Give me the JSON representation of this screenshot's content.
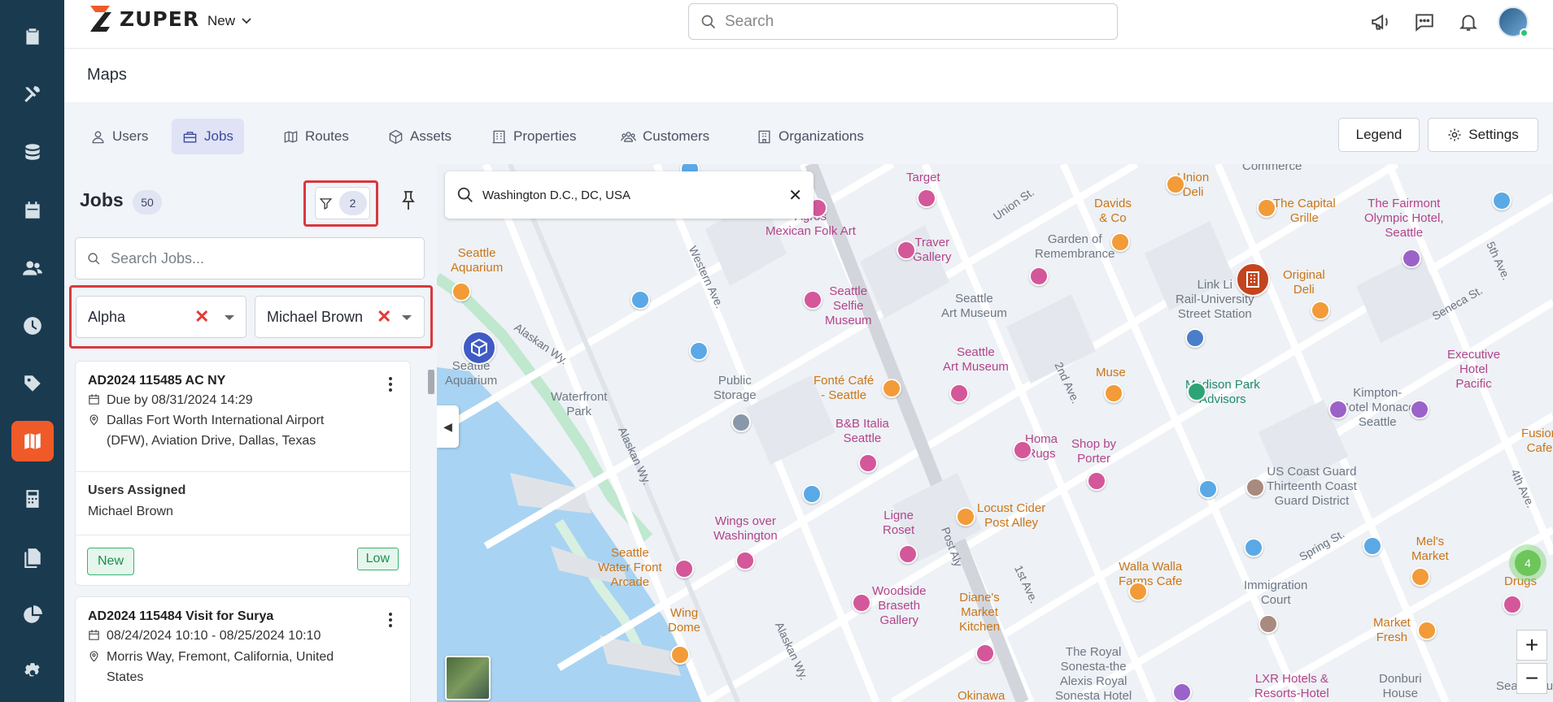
{
  "app": {
    "logo_text": "ZUPER",
    "new_label": "New",
    "search_placeholder": "Search"
  },
  "sidebar": {
    "items": [
      {
        "name": "clipboard-icon"
      },
      {
        "name": "tools-icon"
      },
      {
        "name": "database-icon"
      },
      {
        "name": "calendar-icon"
      },
      {
        "name": "users-icon"
      },
      {
        "name": "clock-icon"
      },
      {
        "name": "tag-icon"
      },
      {
        "name": "map-icon",
        "active": true
      },
      {
        "name": "calculator-icon"
      },
      {
        "name": "documents-icon"
      },
      {
        "name": "pie-chart-icon"
      },
      {
        "name": "gear-icon"
      }
    ]
  },
  "header": {
    "page_title": "Maps"
  },
  "tabs": [
    {
      "label": "Users",
      "icon": "user-icon"
    },
    {
      "label": "Jobs",
      "icon": "briefcase-icon",
      "active": true
    },
    {
      "label": "Routes",
      "icon": "map-icon"
    },
    {
      "label": "Assets",
      "icon": "cube-icon"
    },
    {
      "label": "Properties",
      "icon": "building-icon"
    },
    {
      "label": "Customers",
      "icon": "customers-icon"
    },
    {
      "label": "Organizations",
      "icon": "organization-icon"
    }
  ],
  "actions": {
    "legend_label": "Legend",
    "settings_label": "Settings"
  },
  "panel": {
    "title": "Jobs",
    "count": "50",
    "filter_count": "2",
    "search_placeholder": "Search Jobs...",
    "filters": [
      {
        "value": "Alpha"
      },
      {
        "value": "Michael Brown"
      }
    ]
  },
  "jobs": [
    {
      "title": "AD2024 115485 AC NY",
      "due": "Due by 08/31/2024 14:29",
      "address_line1": "Dallas Fort Worth International Airport",
      "address_line2": "(DFW), Aviation Drive, Dallas, Texas",
      "users_heading": "Users Assigned",
      "user": "Michael Brown",
      "status": "New",
      "priority": "Low"
    },
    {
      "title": "AD2024 115484 Visit for Surya",
      "due": "08/24/2024 10:10 - 08/25/2024 10:10",
      "address_line1": "Morris Way, Fremont, California, United",
      "address_line2": "States"
    }
  ],
  "map": {
    "search_value": "Washington D.C., DC, USA",
    "cluster_count": "4",
    "zoom_in": "+",
    "zoom_out": "−",
    "labels": {
      "commerce": "Commerce",
      "target": "Target",
      "union_deli": "Union\nDeli",
      "union_st": "Union St.",
      "davids": "Davids\n& Co",
      "capital_grille": "The Capital\nGrille",
      "fairmont": "The Fairmont\nOlympic Hotel,\nSeattle",
      "agros": "Agros\nMexican Folk Art",
      "traver": "Traver\nGallery",
      "garden": "Garden of\nRemembrance",
      "fifth": "5th Ave.",
      "aquarium": "Seattle\nAquarium",
      "western": "Western Ave.",
      "selfie": "Seattle\nSelfie\nMuseum",
      "art_museum1": "Seattle\nArt Museum",
      "link_light": "Link Li\nRail-University\nStreet Station",
      "original_deli": "Original\nDeli",
      "seneca": "Seneca St.",
      "alaskan1": "Alaskan Wy.",
      "aquarium2": "Seattle\nAquarium",
      "art_museum2": "Seattle\nArt Museum",
      "executive": "Executive\nHotel\nPacific",
      "public_storage": "Public\nStorage",
      "fonte": "Fonté Café\n- Seattle",
      "waterfront_park": "Waterfront\nPark",
      "muse": "Muse",
      "madison": "Madison Park\nAdvisors",
      "second": "2nd Ave.",
      "kimpton": "Kimpton-\nHotel Monaco\nSeattle",
      "fusion": "Fusion\nCafe",
      "bb_italia": "B&B Italia\nSeattle",
      "homa": "Homa\nRugs",
      "shop_porter": "Shop by\nPorter",
      "alaskan2": "Alaskan Wy.",
      "coast_guard": "US Coast Guard\nThirteenth Coast\nGuard District",
      "fourth": "4th Ave.",
      "locust": "Locust Cider\nPost Alley",
      "wings": "Wings over\nWashington",
      "ligne": "Ligne\nRoset",
      "post_aly": "Post Aly",
      "first": "1st Ave.",
      "walla": "Walla Walla\nFarms Cafe",
      "spring": "Spring St.",
      "mels": "Mel's\nMarket",
      "drugs": "B\nDrugs",
      "water_front_arcade": "Seattle\nWater Front\nArcade",
      "woodside": "Woodside\nBraseth\nGallery",
      "dianes": "Diane's\nMarket\nKitchen",
      "immigration": "Immigration\nCourt",
      "market_fresh": "Market\nFresh",
      "wing_dome": "Wing\nDome",
      "alaskan3": "Alaskan Wy.",
      "royal": "The Royal\nSonesta-the\nAlexis Royal\nSonesta Hotel",
      "lxr": "LXR Hotels &\nResorts-Hotel",
      "donburi": "Donburi\nHouse",
      "seattle_hu": "Seattle Hu",
      "okinawa": "Okinawa"
    }
  }
}
